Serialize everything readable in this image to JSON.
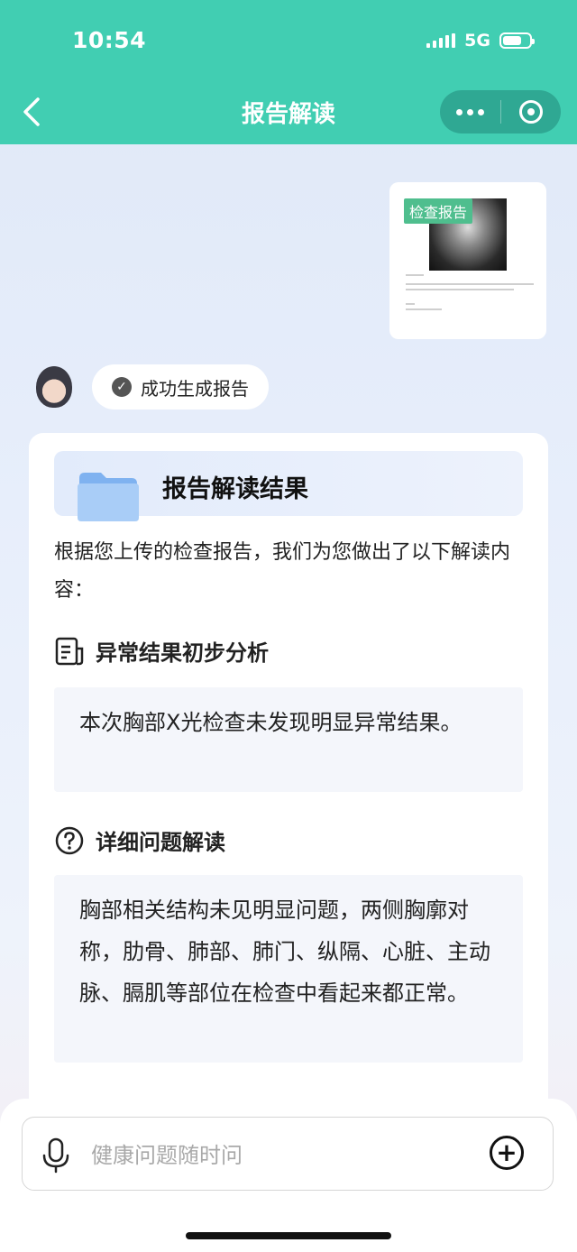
{
  "status_bar": {
    "time": "10:54",
    "network": "5G",
    "battery_level": 0.7
  },
  "nav": {
    "title": "报告解读"
  },
  "colors": {
    "header": "#41ceb2",
    "capsule": "#2fa893",
    "badge": "#4fbe8e",
    "section_bg": "#f4f6fb"
  },
  "report_thumbnail": {
    "badge": "检查报告"
  },
  "assistant": {
    "status_text": "成功生成报告"
  },
  "result_card": {
    "title": "报告解读结果",
    "intro": "根据您上传的检查报告，我们为您做出了以下解读内容：",
    "sections": [
      {
        "icon": "document-icon",
        "title": "异常结果初步分析",
        "body": "本次胸部X光检查未发现明显异常结果。"
      },
      {
        "icon": "question-icon",
        "title": "详细问题解读",
        "body": "胸部相关结构未见明显问题，两侧胸廓对称，肋骨、肺部、肺门、纵隔、心脏、主动脉、膈肌等部位在检查中看起来都正常。"
      }
    ]
  },
  "input": {
    "placeholder": "健康问题随时问"
  }
}
